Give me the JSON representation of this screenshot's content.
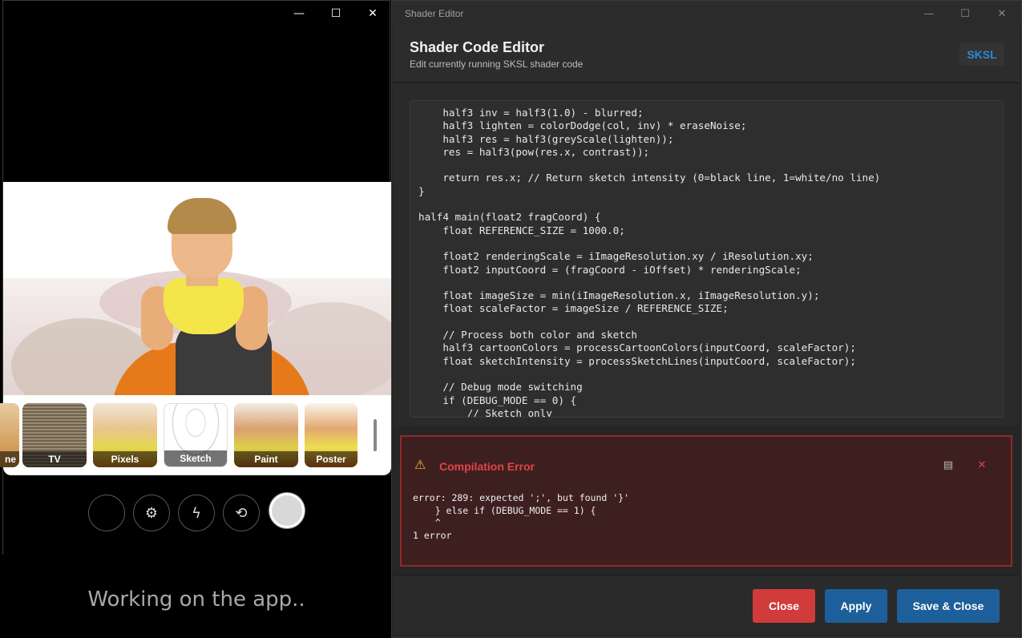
{
  "camera_window": {
    "controls": {
      "minimize": "—",
      "maximize": "☐",
      "close": "✕"
    },
    "filters": [
      {
        "label": "ne"
      },
      {
        "label": "TV"
      },
      {
        "label": "Pixels"
      },
      {
        "label": "Sketch"
      },
      {
        "label": "Paint"
      },
      {
        "label": "Poster"
      }
    ],
    "camera_controls": {
      "settings_icon": "⚙",
      "flash_icon": "ϟ",
      "switch_icon": "⟲"
    }
  },
  "caption": "Working on the app..",
  "editor_window": {
    "title": "Shader Editor",
    "controls": {
      "minimize": "—",
      "maximize": "☐",
      "close": "✕"
    },
    "header": {
      "title": "Shader Code Editor",
      "subtitle": "Edit currently running SKSL shader code",
      "badge": "SKSL"
    },
    "code": "    half3 inv = half3(1.0) - blurred;\n    half3 lighten = colorDodge(col, inv) * eraseNoise;\n    half3 res = half3(greyScale(lighten));\n    res = half3(pow(res.x, contrast));\n\n    return res.x; // Return sketch intensity (0=black line, 1=white/no line)\n}\n\nhalf4 main(float2 fragCoord) {\n    float REFERENCE_SIZE = 1000.0;\n\n    float2 renderingScale = iImageResolution.xy / iResolution.xy;\n    float2 inputCoord = (fragCoord - iOffset) * renderingScale;\n\n    float imageSize = min(iImageResolution.x, iImageResolution.y);\n    float scaleFactor = imageSize / REFERENCE_SIZE;\n\n    // Process both color and sketch\n    half3 cartoonColors = processCartoonColors(inputCoord, scaleFactor);\n    float sketchIntensity = processSketchLines(inputCoord, scaleFactor);\n\n    // Debug mode switching\n    if (DEBUG_MODE == 0) {\n        // Sketch only",
    "error": {
      "icon": "⚠",
      "title": "Compilation Error",
      "copy_icon": "▤",
      "close_icon": "✕",
      "message": "error: 289: expected ';', but found '}'\n    } else if (DEBUG_MODE == 1) {\n    ^\n1 error"
    },
    "buttons": {
      "close": "Close",
      "apply": "Apply",
      "save_close": "Save & Close"
    }
  }
}
